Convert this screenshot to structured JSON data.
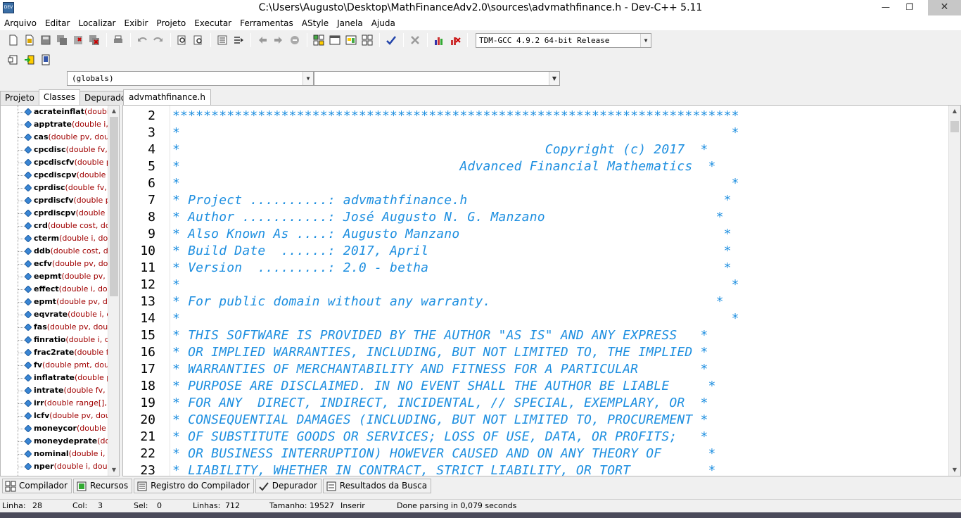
{
  "window": {
    "title": "C:\\Users\\Augusto\\Desktop\\MathFinanceAdv2.0\\sources\\advmathfinance.h - Dev-C++ 5.11",
    "icon_label": "DEV",
    "min_glyph": "—",
    "max_glyph": "❐",
    "close_glyph": "✕"
  },
  "menu": [
    "Arquivo",
    "Editar",
    "Localizar",
    "Exibir",
    "Projeto",
    "Executar",
    "Ferramentas",
    "AStyle",
    "Janela",
    "Ajuda"
  ],
  "toolbar": {
    "compiler": "TDM-GCC 4.9.2 64-bit Release",
    "dropdown_glyph": "▼"
  },
  "scope": {
    "globals": "(globals)"
  },
  "left_tabs": [
    "Projeto",
    "Classes",
    "Depurador"
  ],
  "classes": [
    {
      "name": "acrateinflat",
      "args": "(double"
    },
    {
      "name": "apptrate",
      "args": "(double i, d"
    },
    {
      "name": "cas",
      "args": "(double pv, doubl"
    },
    {
      "name": "cpcdisc",
      "args": "(double fv, d"
    },
    {
      "name": "cpcdiscfv",
      "args": "(double pv"
    },
    {
      "name": "cpcdiscpv",
      "args": "(double fv"
    },
    {
      "name": "cprdisc",
      "args": "(double fv, d"
    },
    {
      "name": "cprdiscfv",
      "args": "(double pv"
    },
    {
      "name": "cprdiscpv",
      "args": "(double fv"
    },
    {
      "name": "crd",
      "args": "(double cost, dou"
    },
    {
      "name": "cterm",
      "args": "(double i, doul"
    },
    {
      "name": "ddb",
      "args": "(double cost, dou"
    },
    {
      "name": "ecfv",
      "args": "(double pv, dou"
    },
    {
      "name": "eepmt",
      "args": "(double pv, d"
    },
    {
      "name": "effect",
      "args": "(double i, dou"
    },
    {
      "name": "epmt",
      "args": "(double pv, dou"
    },
    {
      "name": "eqvrate",
      "args": "(double i, do"
    },
    {
      "name": "fas",
      "args": "(double pv, doubl"
    },
    {
      "name": "finratio",
      "args": "(double i, do"
    },
    {
      "name": "frac2rate",
      "args": "(double fra"
    },
    {
      "name": "fv",
      "args": "(double pmt, doubl"
    },
    {
      "name": "inflatrate",
      "args": "(double pr"
    },
    {
      "name": "intrate",
      "args": "(double fv, de"
    },
    {
      "name": "irr",
      "args": "(double range[], in"
    },
    {
      "name": "lcfv",
      "args": "(double pv, doub"
    },
    {
      "name": "moneycor",
      "args": "(double p"
    },
    {
      "name": "moneydeprate",
      "args": "(dou"
    },
    {
      "name": "nominal",
      "args": "(double i, de"
    },
    {
      "name": "nper",
      "args": "(double i, double"
    }
  ],
  "editor": {
    "tab": "advmathfinance.h",
    "lines": [
      {
        "num": "2",
        "text": "*************************************************************************"
      },
      {
        "num": "3",
        "text": "*                                                                       *"
      },
      {
        "num": "4",
        "text": "*                                               Copyright (c) 2017  *"
      },
      {
        "num": "5",
        "text": "*                                    Advanced Financial Mathematics  *"
      },
      {
        "num": "6",
        "text": "*                                                                       *"
      },
      {
        "num": "7",
        "text": "* Project ..........: advmathfinance.h                                 *"
      },
      {
        "num": "8",
        "text": "* Author ...........: José Augusto N. G. Manzano                      *"
      },
      {
        "num": "9",
        "text": "* Also Known As ....: Augusto Manzano                                  *"
      },
      {
        "num": "10",
        "text": "* Build Date  ......: 2017, April                                      *"
      },
      {
        "num": "11",
        "text": "* Version  .........: 2.0 - betha                                      *"
      },
      {
        "num": "12",
        "text": "*                                                                       *"
      },
      {
        "num": "13",
        "text": "* For public domain without any warranty.                             *"
      },
      {
        "num": "14",
        "text": "*                                                                       *"
      },
      {
        "num": "15",
        "text": "* THIS SOFTWARE IS PROVIDED BY THE AUTHOR \"AS IS\" AND ANY EXPRESS   *"
      },
      {
        "num": "16",
        "text": "* OR IMPLIED WARRANTIES, INCLUDING, BUT NOT LIMITED TO, THE IMPLIED *"
      },
      {
        "num": "17",
        "text": "* WARRANTIES OF MERCHANTABILITY AND FITNESS FOR A PARTICULAR        *"
      },
      {
        "num": "18",
        "text": "* PURPOSE ARE DISCLAIMED. IN NO EVENT SHALL THE AUTHOR BE LIABLE     *"
      },
      {
        "num": "19",
        "text": "* FOR ANY  DIRECT, INDIRECT, INCIDENTAL, // SPECIAL, EXEMPLARY, OR  *"
      },
      {
        "num": "20",
        "text": "* CONSEQUENTIAL DAMAGES (INCLUDING, BUT NOT LIMITED TO, PROCUREMENT *"
      },
      {
        "num": "21",
        "text": "* OF SUBSTITUTE GOODS OR SERVICES; LOSS OF USE, DATA, OR PROFITS;   *"
      },
      {
        "num": "22",
        "text": "* OR BUSINESS INTERRUPTION) HOWEVER CAUSED AND ON ANY THEORY OF      *"
      },
      {
        "num": "23",
        "text": "* LIABILITY, WHETHER IN CONTRACT, STRICT LIABILITY, OR TORT          *"
      }
    ]
  },
  "bottom_tabs": [
    "Compilador",
    "Recursos",
    "Registro do Compilador",
    "Depurador",
    "Resultados da Busca"
  ],
  "status": {
    "linha_label": "Linha:",
    "linha": "28",
    "col_label": "Col:",
    "col": "3",
    "sel_label": "Sel:",
    "sel": "0",
    "linhas_label": "Linhas:",
    "linhas": "712",
    "tamanho_label": "Tamanho:",
    "tamanho": "19527",
    "mode": "Inserir",
    "message": "Done parsing in 0,079 seconds"
  },
  "colors": {
    "comment": "#1e8fe0",
    "args": "#a00000"
  }
}
